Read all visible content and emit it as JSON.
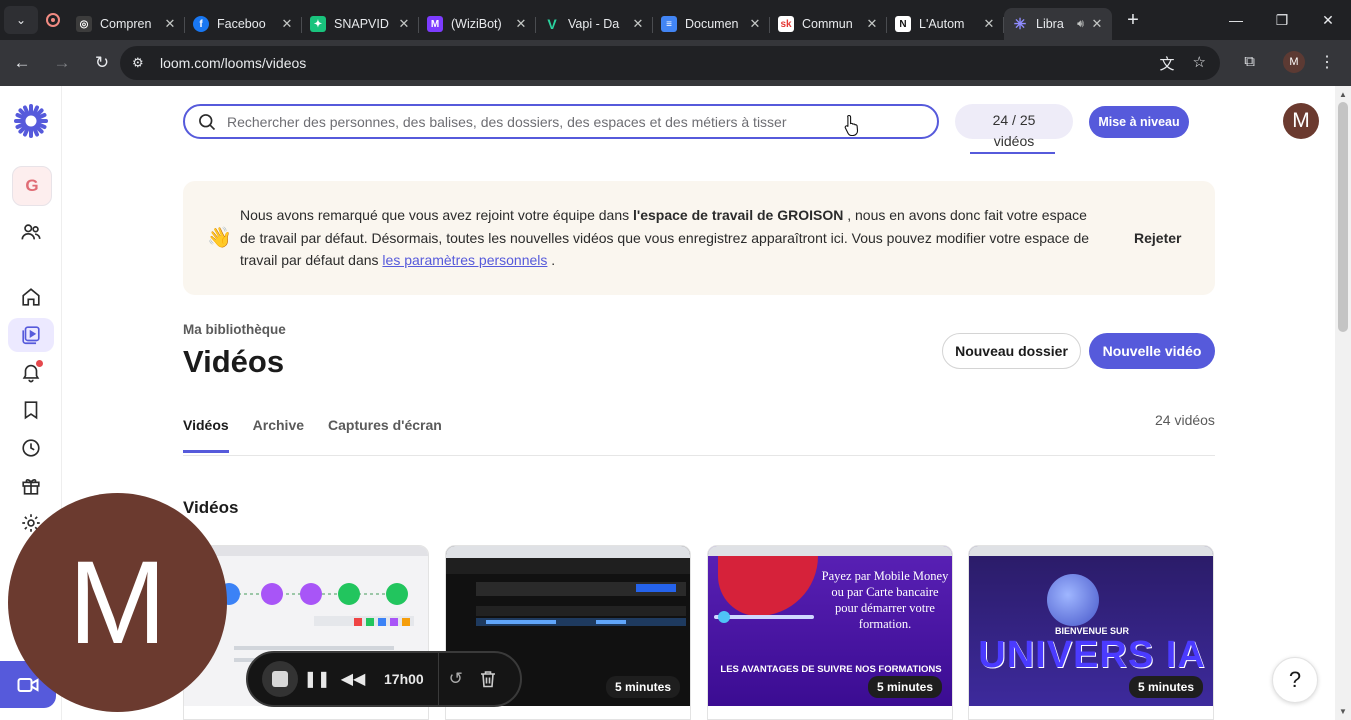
{
  "browser": {
    "tabs": [
      {
        "title": "Compren",
        "favicon_color": "#3c3c3c",
        "favicon_glyph": "◎"
      },
      {
        "title": "Faceboo",
        "favicon_color": "#1877f2",
        "favicon_glyph": "f"
      },
      {
        "title": "SNAPVID",
        "favicon_color": "#19c37d",
        "favicon_glyph": "✦"
      },
      {
        "title": "(WiziBot)",
        "favicon_color": "#7d3cff",
        "favicon_glyph": "M"
      },
      {
        "title": "Vapi - Da",
        "favicon_color": "#2ad4a0",
        "favicon_glyph": "V"
      },
      {
        "title": "Documen",
        "favicon_color": "#4285f4",
        "favicon_glyph": "≡"
      },
      {
        "title": "Commun",
        "favicon_color": "#e53935",
        "favicon_glyph": "sk"
      },
      {
        "title": "L'Autom",
        "favicon_color": "#2b2b2b",
        "favicon_glyph": "N"
      }
    ],
    "active_tab": {
      "title": "Libra"
    },
    "url": "loom.com/looms/videos"
  },
  "header": {
    "search_placeholder": "Rechercher des personnes, des balises, des dossiers, des espaces et des métiers à tisser",
    "quota_count": "24 / 25",
    "quota_unit": "vidéos",
    "upgrade_label": "Mise à niveau",
    "avatar_letter": "M"
  },
  "sidebar": {
    "workspace_letter": "G"
  },
  "banner": {
    "text_before": "Nous avons remarqué que vous avez rejoint votre équipe dans ",
    "workspace_bold": "l'espace de travail de GROISON",
    "text_after": " , nous en avons donc fait votre espace de travail par défaut. Désormais, toutes les nouvelles vidéos que vous enregistrez apparaîtront ici. Vous pouvez modifier votre espace de travail par défaut dans ",
    "link": "les paramètres personnels",
    "text_end": " .",
    "dismiss_label": "Rejeter"
  },
  "library": {
    "breadcrumb": "Ma bibliothèque",
    "title": "Vidéos",
    "new_folder_label": "Nouveau dossier",
    "new_video_label": "Nouvelle vidéo",
    "tabs": [
      "Vidéos",
      "Archive",
      "Captures d'écran"
    ],
    "count": "24 vidéos",
    "section_title": "Vidéos"
  },
  "videos": [
    {
      "duration": ""
    },
    {
      "duration": "5 minutes"
    },
    {
      "duration": "5 minutes",
      "thumb_text": "Payez par Mobile Money ou par Carte bancaire pour démarrer votre formation.",
      "thumb_banner": "LES AVANTAGES DE SUIVRE NOS FORMATIONS"
    },
    {
      "duration": "5 minutes",
      "thumb_small": "BIENVENUE SUR",
      "thumb_big": "UNIVERS IA"
    }
  ],
  "recorder": {
    "bubble_letter": "M",
    "time": "17h00"
  },
  "help_label": "?"
}
